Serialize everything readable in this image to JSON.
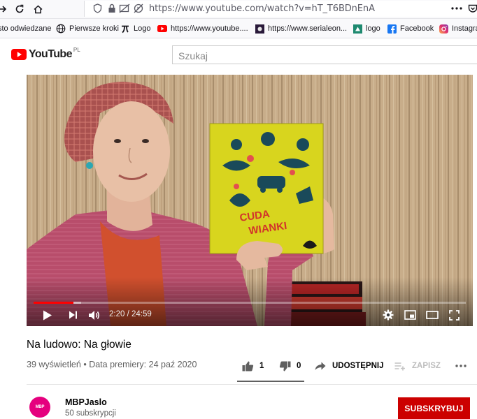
{
  "browser": {
    "url": "https://www.youtube.com/watch?v=hT_T6BDnEnA",
    "bookmarks": [
      {
        "label": "sto odwiedzane",
        "icon": "none"
      },
      {
        "label": "Pierwsze kroki",
        "icon": "globe-icon"
      },
      {
        "label": "Logo",
        "icon": "tau-logo-icon"
      },
      {
        "label": "https://www.youtube....",
        "icon": "youtube-icon"
      },
      {
        "label": "https://www.serialeon...",
        "icon": "site-icon"
      },
      {
        "label": "logo",
        "icon": "site-icon"
      },
      {
        "label": "Facebook",
        "icon": "facebook-icon"
      },
      {
        "label": "Instagram",
        "icon": "instagram-icon"
      }
    ]
  },
  "header": {
    "logo_text": "YouTube",
    "region": "PL",
    "search_placeholder": "Szukaj"
  },
  "player": {
    "current_time": "2:20",
    "duration": "24:59",
    "time_display": "2:20 / 24:59",
    "played_fraction": 0.093,
    "buffered_fraction": 0.11,
    "book_title": "CUDA WIANKI"
  },
  "video": {
    "title": "Na ludowo: Na głowie",
    "views": "39 wyświetleń",
    "separator": "•",
    "premiere": "Data premiery: 24 paź 2020",
    "likes": "1",
    "dislikes": "0",
    "like_fraction": 1.0,
    "share_label": "UDOSTĘPNIJ",
    "save_label": "ZAPISZ"
  },
  "channel": {
    "name": "MBPJaslo",
    "subscribers": "50 subskrypcji",
    "subscribe_label": "SUBSKRYBUJ"
  },
  "colors": {
    "accent": "#ff0000",
    "subscribe": "#cc0000",
    "avatar": "#e5007e"
  }
}
